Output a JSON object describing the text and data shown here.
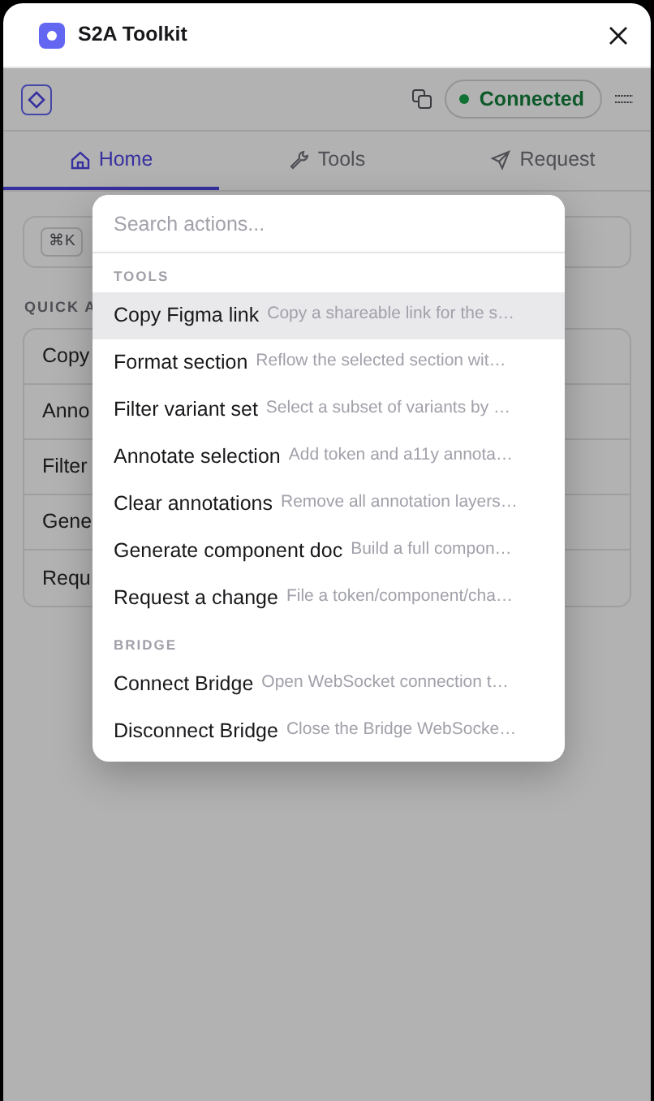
{
  "window": {
    "title": "S2A Toolkit"
  },
  "header": {
    "status": "Connected",
    "connected": true
  },
  "tabs": [
    {
      "label": "Home",
      "selected": true
    },
    {
      "label": "Tools",
      "selected": false
    },
    {
      "label": "Request",
      "selected": false
    }
  ],
  "search": {
    "shortcut": "⌘K"
  },
  "quick_actions": {
    "heading": "QUICK A",
    "items": [
      "Copy",
      "Anno",
      "Filter",
      "Gene",
      "Requ"
    ]
  },
  "palette": {
    "placeholder": "Search actions...",
    "groups": [
      {
        "heading": "TOOLS",
        "items": [
          {
            "name": "Copy Figma link",
            "description": "Copy a shareable link for the s…",
            "selected": true
          },
          {
            "name": "Format section",
            "description": "Reflow the selected section wit…",
            "selected": false
          },
          {
            "name": "Filter variant set",
            "description": "Select a subset of variants by …",
            "selected": false
          },
          {
            "name": "Annotate selection",
            "description": "Add token and a11y annota…",
            "selected": false
          },
          {
            "name": "Clear annotations",
            "description": "Remove all annotation layers…",
            "selected": false
          },
          {
            "name": "Generate component doc",
            "description": "Build a full compon…",
            "selected": false
          },
          {
            "name": "Request a change",
            "description": "File a token/component/cha…",
            "selected": false
          }
        ]
      },
      {
        "heading": "BRIDGE",
        "items": [
          {
            "name": "Connect Bridge",
            "description": "Open WebSocket connection t…",
            "selected": false
          },
          {
            "name": "Disconnect Bridge",
            "description": "Close the Bridge WebSocke…",
            "selected": false
          }
        ]
      }
    ]
  }
}
